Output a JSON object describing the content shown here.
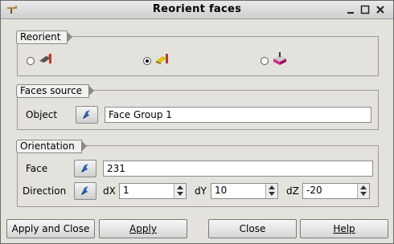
{
  "window": {
    "title": "Reorient faces"
  },
  "reorient": {
    "label": "Reorient",
    "options": [
      {
        "icon": "face-by-point-icon",
        "selected": false
      },
      {
        "icon": "face-by-vector-icon",
        "selected": true
      },
      {
        "icon": "volume-icon",
        "selected": false
      }
    ]
  },
  "faces_source": {
    "label": "Faces source",
    "object_label": "Object",
    "object_value": "Face Group 1"
  },
  "orientation": {
    "label": "Orientation",
    "face_label": "Face",
    "face_value": "231",
    "direction_label": "Direction",
    "dx_label": "dX",
    "dx_value": "1",
    "dy_label": "dY",
    "dy_value": "10",
    "dz_label": "dZ",
    "dz_value": "-20"
  },
  "buttons": {
    "apply_close": "Apply and Close",
    "apply": "Apply",
    "close": "Close",
    "help": "Help"
  }
}
